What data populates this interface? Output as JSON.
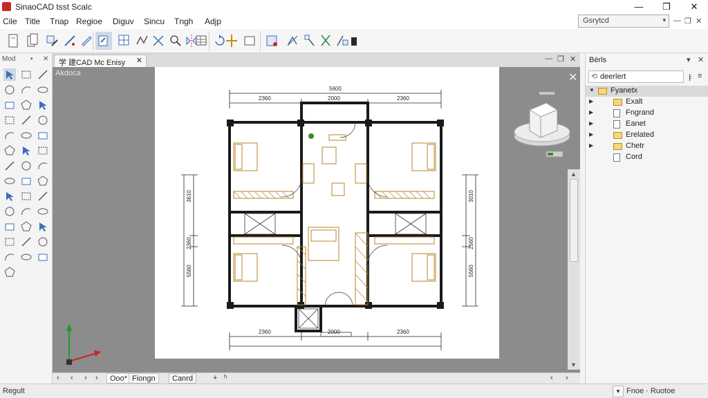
{
  "window": {
    "title": "SinaoCAD tsst Scalc",
    "minimize": "—",
    "restore": "❐",
    "close": "✕"
  },
  "menu": {
    "items": [
      "Cile",
      "Title",
      "Tnap",
      "Regioe",
      "Diguv",
      "Sincu",
      "Tngh",
      "Adjp"
    ],
    "layer_value": "Gsrytcd",
    "ctrl_min": "—",
    "ctrl_restore": "❐",
    "ctrl_close": "✕"
  },
  "toolbar": {
    "icons": [
      "open-file-icon",
      "copy-file-icon",
      "pencil-icon",
      "transform-icon",
      "pen-icon",
      "select-icon",
      "grid-icon",
      "polyline-icon",
      "explode-icon",
      "zoom-icon",
      "table-icon",
      "mirror-icon",
      "rotate-icon",
      "scale-icon",
      "move-icon",
      "rectangle-icon",
      "camera-icon",
      "trim-icon",
      "extend-icon",
      "fillet-icon",
      "array-icon",
      "offset-icon",
      "snap-icon"
    ]
  },
  "left_panel": {
    "title": "Mod",
    "ctrl_a": "▪",
    "ctrl_close": "✕",
    "tools": [
      "select-arrow-icon",
      "window-select-icon",
      "line-icon",
      "circle-icon",
      "arc-icon",
      "ellipse-icon",
      "rectangle-icon",
      "polygon-icon",
      "move-icon",
      "copy-icon",
      "rotate-icon",
      "scale-icon",
      "stretch-icon",
      "trim-icon",
      "extend-icon",
      "fillet-icon",
      "mirror-icon",
      "offset-icon",
      "hatch-icon",
      "text-icon",
      "dimension-icon",
      "leader-icon",
      "block-icon",
      "insert-icon",
      "erase-icon",
      "explode-icon",
      "join-icon",
      "break-icon",
      "measure-icon",
      "layer-icon",
      "undo-icon",
      "redo-icon",
      "pan-icon",
      "zoom-icon",
      "grip-icon",
      "point-icon",
      "spline-icon",
      "region-icon",
      "boundary-icon",
      "wipeout-icon"
    ]
  },
  "document": {
    "tab_label": "学 建CAD  Mc Enisy",
    "tab_close": "✕",
    "ctrl_min": "—",
    "ctrl_restore": "❐",
    "ctrl_close": "✕",
    "viewport_label": "Akdoca",
    "vscroll_up": "▲",
    "vscroll_down": "▼"
  },
  "plan": {
    "dims": {
      "top_overall": "5600",
      "top_a": "2360",
      "top_b": "2000",
      "top_c": "2360",
      "bottom_a": "2360",
      "bottom_b": "2000",
      "bottom_c": "2360",
      "left_a": "3610",
      "left_b": "2360",
      "left_c": "5560",
      "right_a": "3010",
      "right_b": "2560",
      "right_c": "5560"
    }
  },
  "bottom_bar": {
    "nav_first": "‹",
    "nav_prev": "‹",
    "nav_next": "›",
    "nav_last": "›",
    "tab_model": "Ooo*",
    "tab_layout1": "Fiongn",
    "tab_layout2": "Canrd",
    "tab_add": "+",
    "tab_menu": "ʰ",
    "scroll_left": "‹",
    "scroll_right": "›"
  },
  "right_panel": {
    "title": "Bérls",
    "ctrl_pin": "▾",
    "ctrl_close": "✕",
    "search_value": "deerlert",
    "search_ctrl1": "ㅑ",
    "search_ctrl2": "≡",
    "tree": [
      {
        "label": "Fyanetx",
        "expanded": true,
        "selected": true,
        "kind": "folder"
      },
      {
        "label": "Exalt",
        "expanded": false,
        "selected": false,
        "kind": "folder"
      },
      {
        "label": "Fngrand",
        "expanded": false,
        "selected": false,
        "kind": "doc"
      },
      {
        "label": "Eanet",
        "expanded": false,
        "selected": false,
        "kind": "doc"
      },
      {
        "label": "Erelated",
        "expanded": false,
        "selected": false,
        "kind": "folder"
      },
      {
        "label": "Chetr",
        "expanded": false,
        "selected": false,
        "kind": "folder"
      },
      {
        "label": "Cord",
        "expanded": false,
        "selected": false,
        "kind": "doc"
      }
    ]
  },
  "status": {
    "left": "Regult",
    "dropdown": "▾",
    "right": "Fnoe · Ruotoe"
  },
  "colors": {
    "brand": "#c62828",
    "canvas": "#8c8c8c",
    "wall": "#1a1a1a",
    "furniture": "#b8832a",
    "axis_x": "#d42020",
    "axis_y": "#1f9a2a"
  }
}
